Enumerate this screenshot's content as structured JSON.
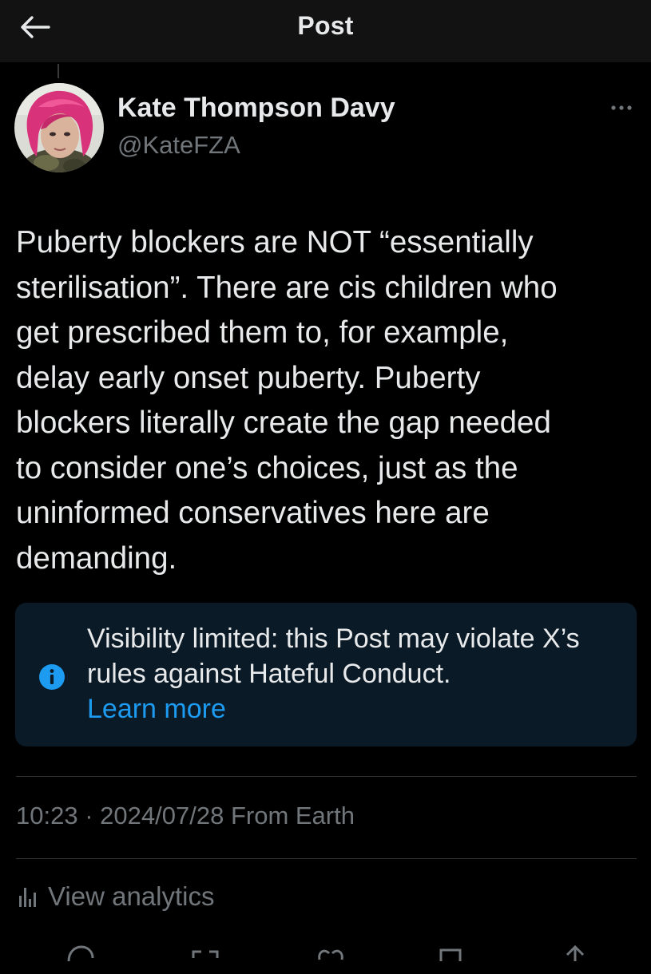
{
  "header": {
    "title": "Post",
    "back_icon": "arrow-left-icon"
  },
  "author": {
    "name": "Kate Thompson Davy",
    "handle": "@KateFZA",
    "avatar_hair_color": "#d8337a"
  },
  "post": {
    "text": "Puberty blockers are NOT “essentially\nsterilisation”. There are cis children who\nget prescribed them to, for example,\ndelay early onset puberty. Puberty\nblockers literally create the gap needed\nto consider one’s choices, just as the\nuninformed conservatives here are\ndemanding."
  },
  "notice": {
    "text": "Visibility limited: this Post may violate X’s rules against Hateful Conduct.",
    "link_label": "Learn more",
    "icon": "info-icon",
    "accent_color": "#1d9bf0"
  },
  "meta": {
    "time": "10:23",
    "separator": "·",
    "date": "2024/07/28",
    "source": "From Earth"
  },
  "analytics": {
    "label": "View analytics",
    "icon": "bar-chart-icon"
  },
  "actions": [
    {
      "icon": "reply-icon"
    },
    {
      "icon": "repost-icon"
    },
    {
      "icon": "like-icon"
    },
    {
      "icon": "bookmark-icon"
    },
    {
      "icon": "share-icon"
    }
  ]
}
